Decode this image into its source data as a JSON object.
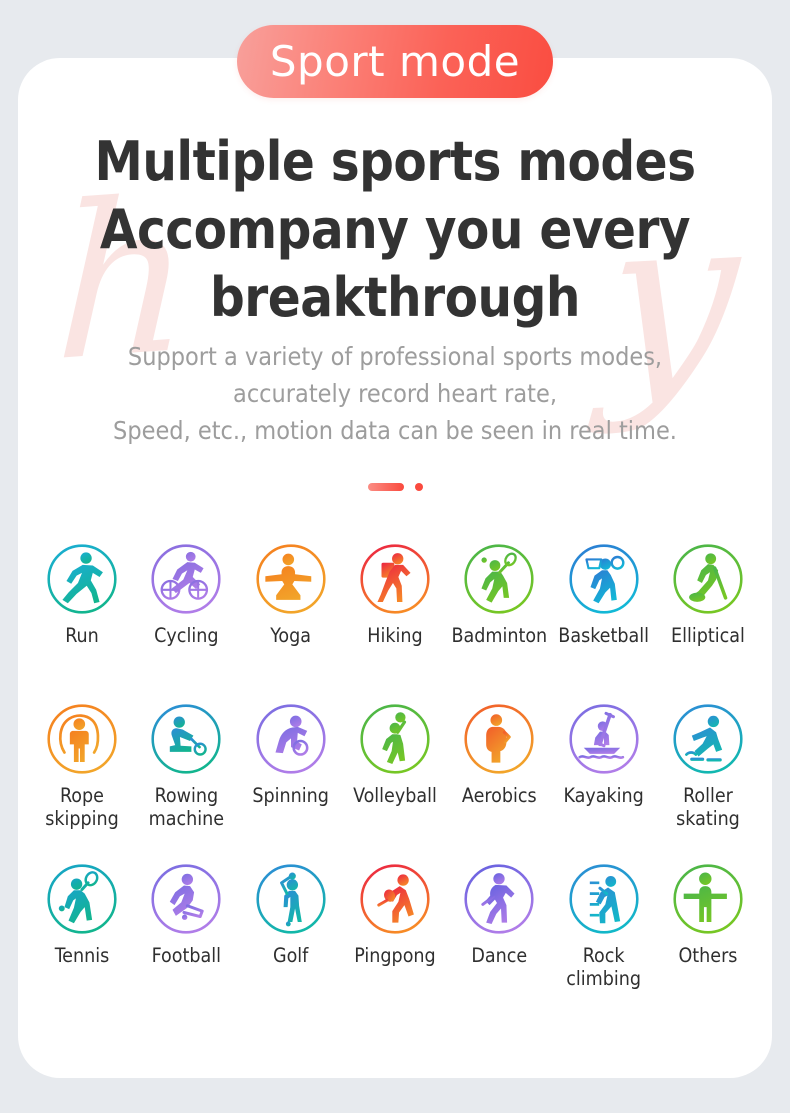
{
  "badge": {
    "label": "Sport mode",
    "gradient_from": "#f8a09b",
    "gradient_to": "#fa4d41"
  },
  "headline": {
    "line1": "Multiple sports modes",
    "line2": "Accompany you every",
    "line3": "breakthrough"
  },
  "subhead": {
    "line1": "Support a variety of professional sports modes,",
    "line2": "accurately record heart rate,",
    "line3": "Speed, etc., motion data can be seen in real time."
  },
  "watermark": {
    "left_letter": "h",
    "right_letter": "y",
    "color": "#fae4e2"
  },
  "pager": {
    "active_index": 0,
    "count": 2,
    "color": "#fa4a3e"
  },
  "sports": {
    "rows": [
      [
        {
          "label": "Run",
          "icon": "run-icon",
          "c1": "#1aaed0",
          "c2": "#12b58e"
        },
        {
          "label": "Cycling",
          "icon": "cycling-icon",
          "c1": "#8b6fe0",
          "c2": "#b07de8"
        },
        {
          "label": "Yoga",
          "icon": "yoga-icon",
          "c1": "#f58220",
          "c2": "#f2a52a"
        },
        {
          "label": "Hiking",
          "icon": "hiking-icon",
          "c1": "#ec2a40",
          "c2": "#f78b26"
        },
        {
          "label": "Badminton",
          "icon": "badminton-icon",
          "c1": "#4cb648",
          "c2": "#77c724"
        },
        {
          "label": "Basketball",
          "icon": "basketball-icon",
          "c1": "#2b7fd4",
          "c2": "#12b9d6"
        },
        {
          "label": "Elliptical",
          "icon": "elliptical-icon",
          "c1": "#4cb648",
          "c2": "#77c724"
        }
      ],
      [
        {
          "label": "Rope\nskipping",
          "icon": "rope-skipping-icon",
          "c1": "#f58220",
          "c2": "#f2a52a"
        },
        {
          "label": "Rowing\nmachine",
          "icon": "rowing-machine-icon",
          "c1": "#2b8fd4",
          "c2": "#12b58e"
        },
        {
          "label": "Spinning",
          "icon": "spinning-icon",
          "c1": "#7d6ee2",
          "c2": "#b07de8"
        },
        {
          "label": "Volleyball",
          "icon": "volleyball-icon",
          "c1": "#4cb648",
          "c2": "#77c724"
        },
        {
          "label": "Aerobics",
          "icon": "aerobics-icon",
          "c1": "#f2622a",
          "c2": "#f2a52a"
        },
        {
          "label": "Kayaking",
          "icon": "kayaking-icon",
          "c1": "#7d6ee2",
          "c2": "#b07de8"
        },
        {
          "label": "Roller\nskating",
          "icon": "roller-skating-icon",
          "c1": "#2b8fd4",
          "c2": "#12b8b0"
        }
      ],
      [
        {
          "label": "Tennis",
          "icon": "tennis-icon",
          "c1": "#17a6c4",
          "c2": "#12b58e"
        },
        {
          "label": "Football",
          "icon": "football-icon",
          "c1": "#7d6ee2",
          "c2": "#b07de8"
        },
        {
          "label": "Golf",
          "icon": "golf-icon",
          "c1": "#2b8fd4",
          "c2": "#12b8a8"
        },
        {
          "label": "Pingpong",
          "icon": "pingpong-icon",
          "c1": "#ec2a40",
          "c2": "#f78b26"
        },
        {
          "label": "Dance",
          "icon": "dance-icon",
          "c1": "#6a63e0",
          "c2": "#b07de8"
        },
        {
          "label": "Rock\nclimbing",
          "icon": "rock-climbing-icon",
          "c1": "#2b8fd4",
          "c2": "#12b8c8"
        },
        {
          "label": "Others",
          "icon": "others-icon",
          "c1": "#4cb648",
          "c2": "#77c724"
        }
      ]
    ]
  }
}
